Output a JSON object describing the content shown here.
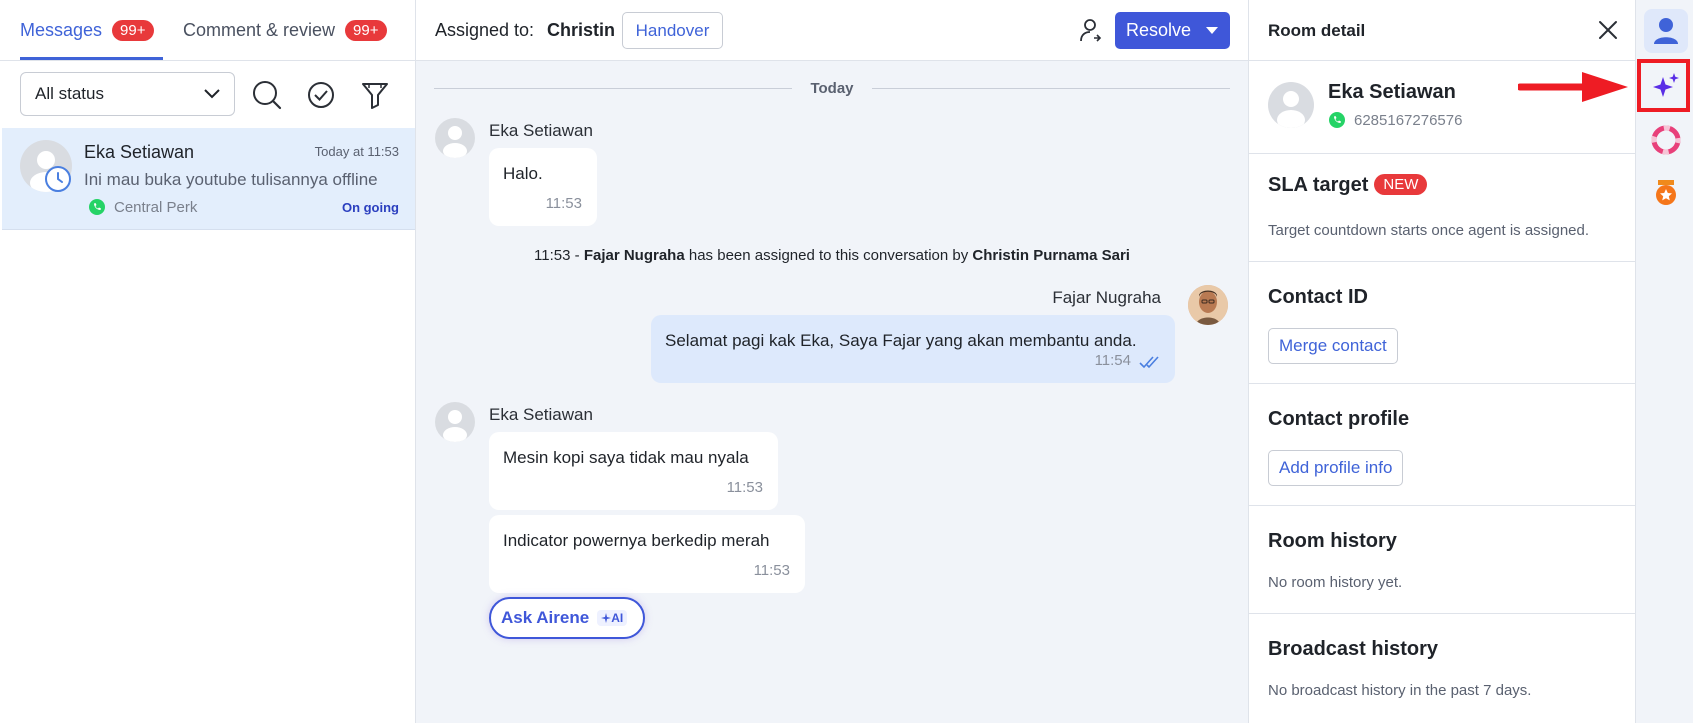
{
  "tabs": [
    {
      "label": "Messages",
      "badge": "99+",
      "active": true
    },
    {
      "label": "Comment & review",
      "badge": "99+",
      "active": false
    }
  ],
  "filters": {
    "status_label": "All status"
  },
  "rooms": [
    {
      "name": "Eka Setiawan",
      "time": "Today at 11:53",
      "preview": "Ini mau buka youtube tulisannya offline",
      "channel": "Central Perk",
      "status": "On going"
    }
  ],
  "chat_header": {
    "assigned_label": "Assigned to:",
    "assigned_name": "Christin",
    "handover_label": "Handover",
    "resolve_label": "Resolve"
  },
  "day_separator": "Today",
  "messages": [
    {
      "sender": "Eka Setiawan",
      "text": "Halo.",
      "time": "11:53"
    },
    {
      "sender": "Fajar Nugraha",
      "text": "Selamat pagi kak Eka, Saya Fajar yang akan membantu anda.",
      "time": "11:54"
    },
    {
      "sender": "Eka Setiawan",
      "text": "Mesin kopi saya tidak mau nyala",
      "time": "11:53"
    },
    {
      "text": "Indicator powernya berkedip merah",
      "time": "11:53"
    }
  ],
  "system_message": {
    "time": "11:53",
    "dash": "-",
    "agent": "Fajar Nugraha",
    "middle": "has been assigned to this conversation by",
    "assigner": "Christin Purnama Sari"
  },
  "ask_airene": {
    "label": "Ask Airene",
    "ai_badge": "AI"
  },
  "room_detail": {
    "title": "Room detail",
    "contact_name": "Eka Setiawan",
    "contact_phone": "6285167276576",
    "sla_title": "SLA target",
    "sla_badge": "NEW",
    "sla_text": "Target countdown starts once agent is assigned.",
    "contact_id_title": "Contact ID",
    "merge_label": "Merge contact",
    "profile_title": "Contact profile",
    "add_profile_label": "Add profile info",
    "room_history_title": "Room history",
    "room_history_text": "No room history yet.",
    "broadcast_title": "Broadcast history",
    "broadcast_text": "No broadcast history in the past 7 days."
  },
  "colors": {
    "accent": "#3f63d8",
    "resolve": "#3f57d9",
    "badge_red": "#e8393b",
    "annotation_red": "#ee1c24",
    "whatsapp_green": "#25d366",
    "selected_room_bg": "#e3eefc"
  },
  "icons": {
    "rail": [
      "user-icon",
      "ai-sparkle-icon",
      "lifebuoy-icon",
      "badge-star-icon"
    ],
    "header": [
      "agent-swap-icon",
      "close-icon"
    ],
    "filters": [
      "search-icon",
      "check-circle-icon",
      "funnel-icon",
      "chevron-down-icon"
    ]
  }
}
